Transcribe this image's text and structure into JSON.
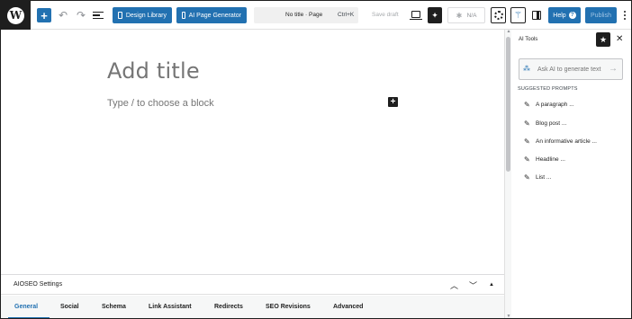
{
  "toolbar": {
    "logo_glyph": "W",
    "design_library_label": "Design Library",
    "ai_page_generator_label": "AI Page Generator",
    "document_title": "No title · Page",
    "command_shortcut": "Ctrl+K",
    "save_draft_label": "Save draft",
    "na_label": "N/A",
    "help_label": "Help",
    "publish_label": "Publish"
  },
  "editor": {
    "title_placeholder": "Add title",
    "block_placeholder": "Type / to choose a block"
  },
  "ai_panel": {
    "title": "AI Tools",
    "input_placeholder": "Ask AI to generate text",
    "suggested_label": "SUGGESTED PROMPTS",
    "prompts": [
      {
        "label": "A paragraph ..."
      },
      {
        "label": "Blog post ..."
      },
      {
        "label": "An informative article ..."
      },
      {
        "label": "Headline ..."
      },
      {
        "label": "List ..."
      }
    ]
  },
  "aioseo": {
    "title": "AIOSEO Settings",
    "tabs": [
      {
        "label": "General",
        "active": true
      },
      {
        "label": "Social"
      },
      {
        "label": "Schema"
      },
      {
        "label": "Link Assistant"
      },
      {
        "label": "Redirects"
      },
      {
        "label": "SEO Revisions"
      },
      {
        "label": "Advanced"
      }
    ]
  },
  "colors": {
    "accent": "#2271b1",
    "dark": "#1e1e1e"
  }
}
